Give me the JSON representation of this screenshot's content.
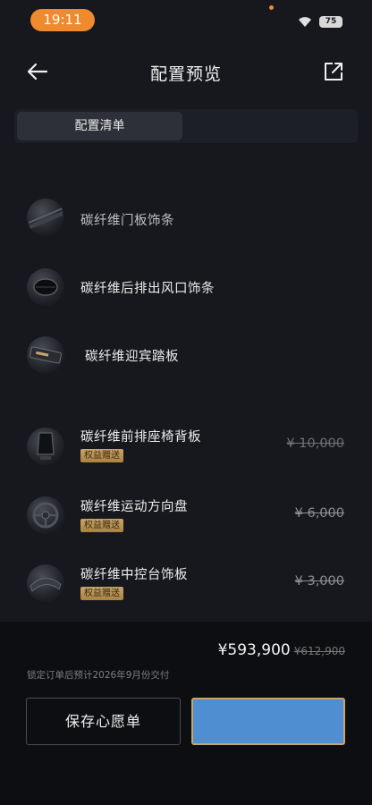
{
  "status_bar": {
    "time": "19:11",
    "battery": "75"
  },
  "header": {
    "title": "配置预览"
  },
  "tabs": [
    {
      "label": "配置清单",
      "active": true
    },
    {
      "label": "",
      "active": false
    }
  ],
  "items": [
    {
      "name": "碳纤维门板饰条",
      "badge": "",
      "price": ""
    },
    {
      "name": "碳纤维后排出风口饰条",
      "badge": "",
      "price": ""
    },
    {
      "name": "碳纤维迎宾踏板",
      "badge": "",
      "price": ""
    },
    {
      "name": "碳纤维前排座椅背板",
      "badge": "权益赠送",
      "price": "¥ 10,000"
    },
    {
      "name": "碳纤维运动方向盘",
      "badge": "权益赠送",
      "price": "¥ 6,000"
    },
    {
      "name": "碳纤维中控台饰板",
      "badge": "权益赠送",
      "price": "¥ 3,000"
    }
  ],
  "bottom": {
    "total": "¥593,900",
    "total_original": "¥612,900",
    "delivery_note": "锁定订单后预计2026年9月份交付",
    "wishlist_label": "保存心愿单",
    "primary_label": ""
  },
  "colors": {
    "background": "#16181d",
    "accent_orange": "#f08a2e",
    "primary_button": "#4f8fd1",
    "badge_gold": "#c9a56a"
  }
}
